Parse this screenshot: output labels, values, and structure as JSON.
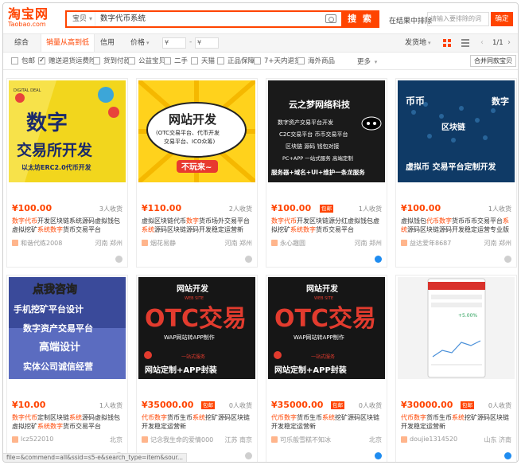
{
  "header": {
    "logo_main": "淘宝网",
    "logo_sub": "Taobao.com",
    "search_category": "宝贝",
    "search_query": "数字代币系统",
    "search_button": "搜 索",
    "exclude_label": "在结果中排除",
    "exclude_placeholder": "请输入要排除的词",
    "confirm_button": "确定"
  },
  "sortbar": {
    "items": [
      "综合",
      "销量从高到低",
      "信用",
      "价格"
    ],
    "price_min_placeholder": "¥",
    "price_max_placeholder": "¥",
    "ship_from": "发货地",
    "page_info": "1/1"
  },
  "filters": {
    "items": [
      {
        "label": "包邮",
        "checked": false
      },
      {
        "label": "赠送退货运费险",
        "checked": true
      },
      {
        "label": "货到付款",
        "checked": false
      },
      {
        "label": "公益宝贝",
        "checked": false
      },
      {
        "label": "二手",
        "checked": false
      },
      {
        "label": "天猫",
        "checked": false
      },
      {
        "label": "正品保障",
        "checked": false
      },
      {
        "label": "7+天内退货",
        "checked": false
      },
      {
        "label": "海外商品",
        "checked": false
      }
    ],
    "more": "更多",
    "compare": "合并同款宝贝"
  },
  "products": [
    {
      "price": "¥100.00",
      "badge": "",
      "sales": "3人收货",
      "title": [
        "数字代币",
        "开发区块链系统源码虚拟钱包虚拟挖矿",
        "系统数字",
        "货币交易平台"
      ],
      "shop": "和谐代练2008",
      "location": "河南 郑州",
      "ww": "grey",
      "img": {
        "line1": "数字",
        "line2": "交易所开发",
        "line3": "以太坊ERC2.0代币开发",
        "tag": "DIGITAL DEAL"
      }
    },
    {
      "price": "¥110.00",
      "badge": "",
      "sales": "2人收货",
      "title": [
        "虚拟区块链代币",
        "数字",
        "货币场外交易平台",
        "系统",
        "源码区块链源码开发稳定运营新"
      ],
      "shop": "烟花易静",
      "location": "河南 郑州",
      "ww": "grey",
      "img": {
        "line1": "网站开发",
        "line2": "(OTC交易平台、代币开发",
        "line3": "交易平台、ICO众筹)",
        "tag": "不玩来~"
      }
    },
    {
      "price": "¥100.00",
      "badge": "包邮",
      "sales": "1人收货",
      "title": [
        "数字代币",
        "开发区块链源分红虚拟钱包虚拟挖矿",
        "系统数字",
        "货币交易平台"
      ],
      "shop": "永心趣圆",
      "location": "河南 郑州",
      "ww": "blue",
      "img": {
        "line1": "云之梦网络科技",
        "line2": "数字资产交易平台开发",
        "line3": "C2C交易平台  币币交易平台",
        "line4": "区块链  源码  钱包对接",
        "line5": "PC+APP 一站式服务  高端定制",
        "line6": "服务器+域名+UI+维护一条龙服务"
      }
    },
    {
      "price": "¥100.00",
      "badge": "",
      "sales": "1人收货",
      "title": [
        "虚拟钱包",
        "代币数字",
        "货币币币交易平台",
        "系统",
        "源码区块链源码开发稳定运营专业版"
      ],
      "shop": "益达爱年8687",
      "location": "河南 郑州",
      "ww": "grey",
      "img": {
        "line1": "币币",
        "line2": "区块链",
        "line3": "数字",
        "line4": "虚拟币 交易平台定制开发"
      }
    },
    {
      "price": "¥10.00",
      "badge": "",
      "sales": "1人收货",
      "title": [
        "数字代币",
        "定制区块链",
        "系统",
        "源码虚拟钱包虚拟挖矿",
        "系统数字",
        "货币交易平台"
      ],
      "shop": "lcz522010",
      "location": "北京",
      "ww": "grey",
      "img": {
        "line1": "点我咨询",
        "line2": "手机挖矿平台设计",
        "line3": "数字资产交易平台",
        "line4": "高端设计",
        "line5": "实体公司诚信经营"
      }
    },
    {
      "price": "¥35000.00",
      "badge": "包邮",
      "sales": "0人收货",
      "title": [
        "代币数字",
        "货币生币",
        "系统",
        "挖矿源码区块链开发稳定运营新"
      ],
      "shop": "记念我生命的爱情000",
      "location": "江苏 南京",
      "ww": "grey",
      "img": {
        "line1": "网站开发",
        "line2": "WEB SITE",
        "line3": "OTC交易",
        "line4": "WAP网站转APP制作",
        "line5": "一站式服务",
        "line6": "网站定制+APP封装"
      }
    },
    {
      "price": "¥35000.00",
      "badge": "包邮",
      "sales": "0人收货",
      "title": [
        "代币数字",
        "货币生币",
        "系统",
        "挖矿源码区块链开发稳定运营新"
      ],
      "shop": "可乐般雪糕不知冰",
      "location": "北京",
      "ww": "blue",
      "img": {
        "line1": "网站开发",
        "line2": "WEB SITE",
        "line3": "OTC交易",
        "line4": "WAP网站转APP制作",
        "line5": "一站式服务",
        "line6": "网站定制+APP封装"
      }
    },
    {
      "price": "¥30000.00",
      "badge": "包邮",
      "sales": "0人收货",
      "title": [
        "代币数字",
        "货币生币",
        "系统",
        "挖矿源码区块链开发稳定运营新"
      ],
      "shop": "doujie1314520",
      "location": "山东 济南",
      "ww": "blue",
      "img": {
        "line1": "+5.00%"
      }
    }
  ],
  "status_bar": "file=&commend=all&ssid=s5-e&search_type=item&sour..."
}
